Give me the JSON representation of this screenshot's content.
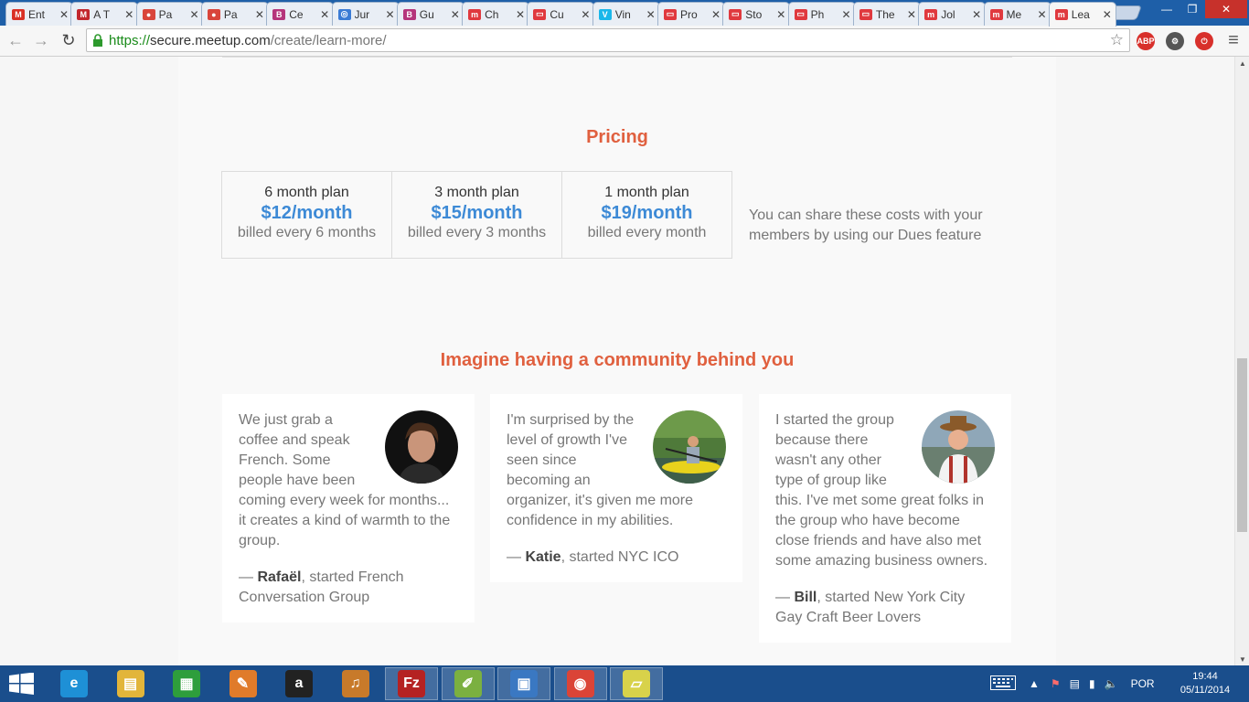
{
  "browser": {
    "tabs": [
      {
        "title": "Ent",
        "favicon": "gmail-icon",
        "color": "#d93025",
        "glyph": "M",
        "active": false
      },
      {
        "title": "A T",
        "favicon": "m-red-icon",
        "color": "#c2272d",
        "glyph": "M",
        "active": false
      },
      {
        "title": "Pa",
        "favicon": "red-circle-icon",
        "color": "#d9453b",
        "glyph": "●",
        "active": false
      },
      {
        "title": "Pa",
        "favicon": "red-circle-icon",
        "color": "#d9453b",
        "glyph": "●",
        "active": false
      },
      {
        "title": "Ce",
        "favicon": "b-pink-icon",
        "color": "#b5357b",
        "glyph": "B",
        "active": false
      },
      {
        "title": "Jur",
        "favicon": "globe-icon",
        "color": "#3a7bd5",
        "glyph": "◎",
        "active": false
      },
      {
        "title": "Gu",
        "favicon": "b-pink-icon",
        "color": "#b5357b",
        "glyph": "B",
        "active": false
      },
      {
        "title": "Ch",
        "favicon": "meetup-icon",
        "color": "#e0393e",
        "glyph": "m",
        "active": false
      },
      {
        "title": "Cu",
        "favicon": "meetup-outline-icon",
        "color": "#e0393e",
        "glyph": "▭",
        "active": false
      },
      {
        "title": "Vin",
        "favicon": "vimeo-icon",
        "color": "#1ab7ea",
        "glyph": "V",
        "active": false
      },
      {
        "title": "Pro",
        "favicon": "meetup-outline-icon",
        "color": "#e0393e",
        "glyph": "▭",
        "active": false
      },
      {
        "title": "Sto",
        "favicon": "meetup-outline-icon",
        "color": "#e0393e",
        "glyph": "▭",
        "active": false
      },
      {
        "title": "Ph",
        "favicon": "meetup-outline-icon",
        "color": "#e0393e",
        "glyph": "▭",
        "active": false
      },
      {
        "title": "The",
        "favicon": "meetup-outline-icon",
        "color": "#e0393e",
        "glyph": "▭",
        "active": false
      },
      {
        "title": "Jol",
        "favicon": "meetup-icon",
        "color": "#e0393e",
        "glyph": "m",
        "active": false
      },
      {
        "title": "Me",
        "favicon": "meetup-icon",
        "color": "#e0393e",
        "glyph": "m",
        "active": false
      },
      {
        "title": "Lea",
        "favicon": "meetup-icon",
        "color": "#e0393e",
        "glyph": "m",
        "active": true
      }
    ],
    "url": {
      "scheme": "https://",
      "host": "secure.meetup.com",
      "path": "/create/learn-more/"
    },
    "extensions": [
      {
        "name": "adblock-plus-icon",
        "label": "ABP",
        "color": "#d8302b"
      },
      {
        "name": "puzzle-extension-icon",
        "label": "⚙",
        "color": "#555555"
      },
      {
        "name": "power-extension-icon",
        "label": "⏻",
        "color": "#d8302b"
      }
    ],
    "menu_glyph": "≡"
  },
  "pricing": {
    "heading": "Pricing",
    "plans": [
      {
        "name": "6 month plan",
        "price": "$12/month",
        "billing": "billed every 6 months"
      },
      {
        "name": "3 month plan",
        "price": "$15/month",
        "billing": "billed every 3 months"
      },
      {
        "name": "1 month plan",
        "price": "$19/month",
        "billing": "billed every month"
      }
    ],
    "dues_note": "You can share these costs with your members by using our Dues feature"
  },
  "community": {
    "heading": "Imagine having a community behind you",
    "testimonials": [
      {
        "quote": "We just grab a coffee and speak French. Some people have been coming every week for months... it creates a kind of warmth to the group.",
        "dash": "— ",
        "name": "Rafaël",
        "group": ", started French Conversation Group"
      },
      {
        "quote": "I'm surprised by the level of growth I've seen since becoming an organizer, it's given me more confidence in my abilities.",
        "dash": "— ",
        "name": "Katie",
        "group": ", started NYC ICO"
      },
      {
        "quote": "I started the group because there wasn't any other type of group like this. I've met some great folks in the group who have become close friends and have also met some amazing business owners.",
        "dash": "— ",
        "name": "Bill",
        "group": ", started New York City Gay Craft Beer Lovers"
      }
    ]
  },
  "taskbar": {
    "apps": [
      {
        "name": "internet-explorer-icon",
        "glyph": "e",
        "color": "#1e90d6",
        "active": false
      },
      {
        "name": "file-explorer-icon",
        "glyph": "▤",
        "color": "#e2b53a",
        "active": false
      },
      {
        "name": "windows-store-icon",
        "glyph": "▦",
        "color": "#2e9e3c",
        "active": false
      },
      {
        "name": "paint-app-icon",
        "glyph": "✎",
        "color": "#e07b2a",
        "active": false
      },
      {
        "name": "amazon-icon",
        "glyph": "a",
        "color": "#222222",
        "active": false
      },
      {
        "name": "media-app-icon",
        "glyph": "♫",
        "color": "#c87a2a",
        "active": false
      },
      {
        "name": "filezilla-icon",
        "glyph": "Fz",
        "color": "#b52222",
        "active": true
      },
      {
        "name": "notepad-chart-icon",
        "glyph": "✐",
        "color": "#7bb040",
        "active": true
      },
      {
        "name": "virtualbox-icon",
        "glyph": "▣",
        "color": "#3a78c2",
        "active": true
      },
      {
        "name": "chrome-icon",
        "glyph": "◉",
        "color": "#db4437",
        "active": true
      },
      {
        "name": "sticky-notes-icon",
        "glyph": "▱",
        "color": "#d8d24a",
        "active": true
      }
    ],
    "language": "POR",
    "time": "19:44",
    "date": "05/11/2014"
  }
}
